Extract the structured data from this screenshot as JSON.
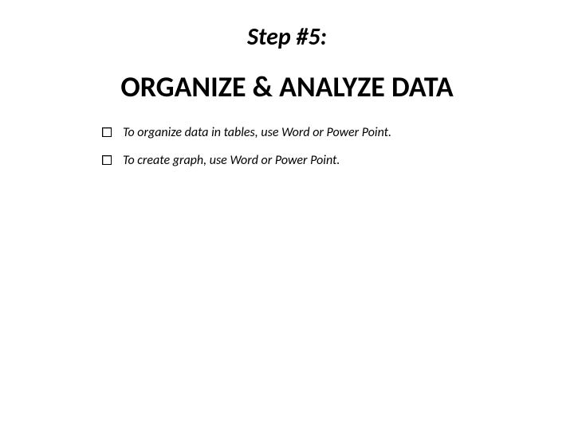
{
  "slide": {
    "step_label": "Step #5:",
    "title": "ORGANIZE & ANALYZE DATA",
    "bullets": [
      {
        "text": "To organize data in tables, use Word or Power Point."
      },
      {
        "text": "To create graph, use Word or Power Point."
      }
    ]
  }
}
